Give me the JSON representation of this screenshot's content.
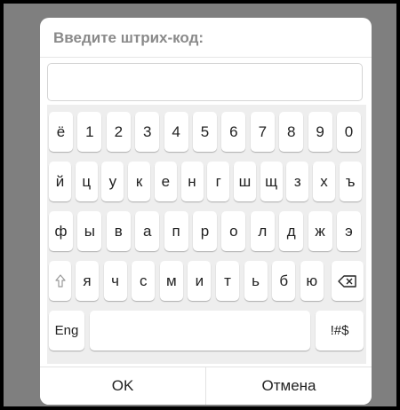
{
  "dialog": {
    "title": "Введите штрих-код:",
    "input_value": "",
    "ok_label": "OK",
    "cancel_label": "Отмена"
  },
  "keyboard": {
    "row1": [
      "ё",
      "1",
      "2",
      "3",
      "4",
      "5",
      "6",
      "7",
      "8",
      "9",
      "0"
    ],
    "row2": [
      "й",
      "ц",
      "у",
      "к",
      "е",
      "н",
      "г",
      "ш",
      "щ",
      "з",
      "х",
      "ъ"
    ],
    "row3": [
      "ф",
      "ы",
      "в",
      "а",
      "п",
      "р",
      "о",
      "л",
      "д",
      "ж",
      "э"
    ],
    "row4": [
      "я",
      "ч",
      "с",
      "м",
      "и",
      "т",
      "ь",
      "б",
      "ю"
    ],
    "shift_icon": "shift-arrow-icon",
    "backspace_icon": "backspace-icon",
    "lang_label": "Eng",
    "symbols_label": "!#$"
  }
}
